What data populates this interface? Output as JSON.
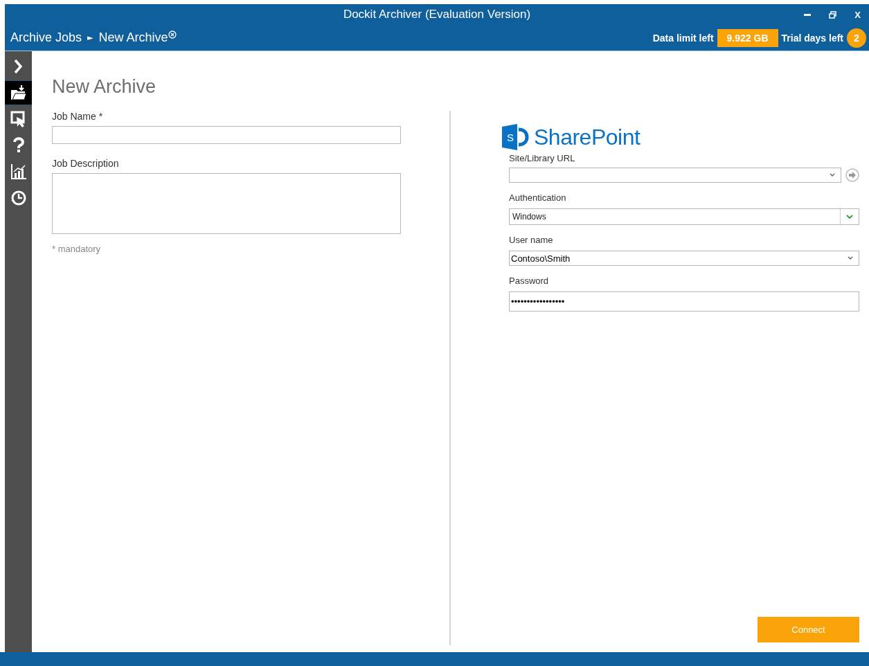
{
  "window": {
    "title": "Dockit Archiver (Evaluation Version)",
    "close_label": "X"
  },
  "breadcrumb": {
    "items": [
      "Archive Jobs",
      "New Archive"
    ],
    "separator": "►"
  },
  "status": {
    "data_label": "Data limit left",
    "data_value": "9.922 GB",
    "trial_label": "Trial days left",
    "trial_value": "2"
  },
  "sidebar": {
    "items": [
      {
        "kind": "expand",
        "selected": false
      },
      {
        "kind": "archive",
        "selected": true
      },
      {
        "kind": "export",
        "selected": false
      },
      {
        "kind": "help",
        "selected": false
      },
      {
        "kind": "reports",
        "selected": false
      },
      {
        "kind": "history",
        "selected": false
      }
    ]
  },
  "form": {
    "title": "New Archive",
    "job_name": {
      "label": "Job Name *"
    },
    "job_description": {
      "label": "Job Description"
    },
    "note": "* mandatory"
  },
  "connection": {
    "logo_letter": "S",
    "logo_text": "SharePoint",
    "fields": [
      {
        "kind": "combo",
        "label": "Site/Library URL",
        "go": true
      },
      {
        "kind": "select",
        "label": "Authentication",
        "value": "Windows"
      },
      {
        "kind": "combo",
        "label": "User name",
        "value": "Contoso\\Smith",
        "go": false
      },
      {
        "kind": "password",
        "label": "Password",
        "value": "•••••••••••••••••"
      }
    ],
    "button": "Connect"
  }
}
